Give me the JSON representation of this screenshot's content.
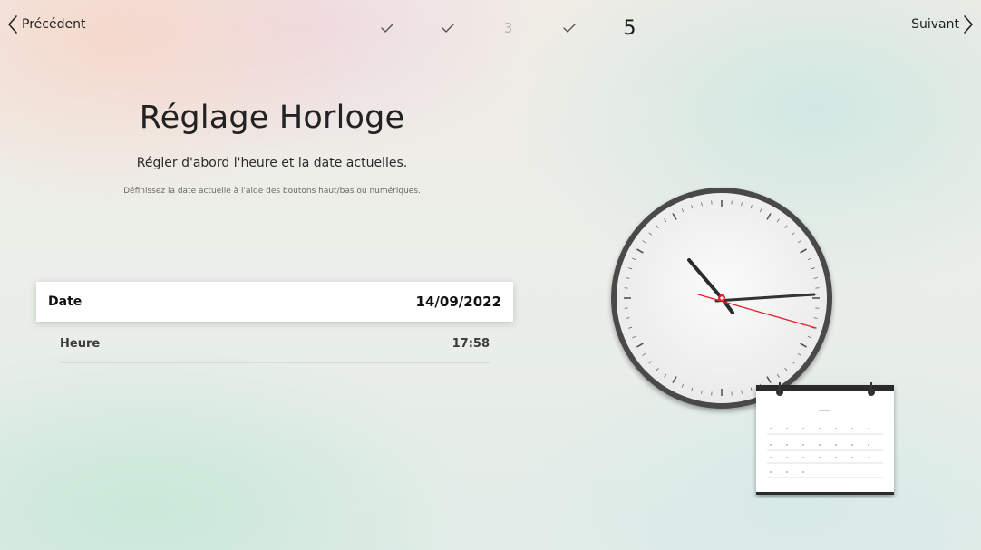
{
  "nav": {
    "prev_label": "Précédent",
    "next_label": "Suivant"
  },
  "steps": [
    {
      "state": "done",
      "icon": "check-icon"
    },
    {
      "state": "done",
      "icon": "check-icon"
    },
    {
      "state": "pending",
      "label": "3"
    },
    {
      "state": "done",
      "icon": "check-icon"
    },
    {
      "state": "current",
      "label": "5"
    }
  ],
  "page": {
    "title": "Réglage Horloge",
    "subtitle": "Régler d'abord l'heure et la date actuelles.",
    "hint": "Définissez la date actuelle à l'aide des boutons haut/bas ou numériques."
  },
  "settings": {
    "date": {
      "label": "Date",
      "value": "14/09/2022"
    },
    "time": {
      "label": "Heure",
      "value": "17:58"
    }
  },
  "colors": {
    "accent": "#e0202a",
    "highlight_row": "#ffffff",
    "text": "#222222"
  }
}
